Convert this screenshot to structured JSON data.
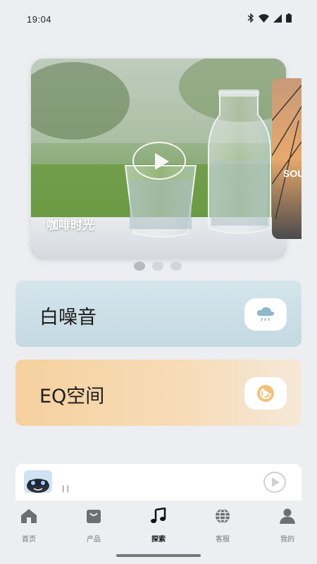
{
  "status": {
    "time": "19:04"
  },
  "carousel": {
    "slides": [
      {
        "title": "咖啡时光"
      },
      {
        "title": "SOU"
      }
    ],
    "dot_count": 3,
    "active_index": 0
  },
  "features": {
    "white_noise_label": "白噪音",
    "eq_label": "EQ空间"
  },
  "mini_player": {
    "title": "| |"
  },
  "nav": {
    "items": [
      {
        "label": "首页",
        "icon": "home-icon"
      },
      {
        "label": "产品",
        "icon": "bag-icon"
      },
      {
        "label": "探索",
        "icon": "music-note-icon"
      },
      {
        "label": "客服",
        "icon": "globe-icon"
      },
      {
        "label": "我的",
        "icon": "person-icon"
      }
    ],
    "active_index": 2
  },
  "colors": {
    "background": "#eceef2",
    "white_noise_card": "#c9dce4",
    "eq_card": "#f6d3a6"
  }
}
